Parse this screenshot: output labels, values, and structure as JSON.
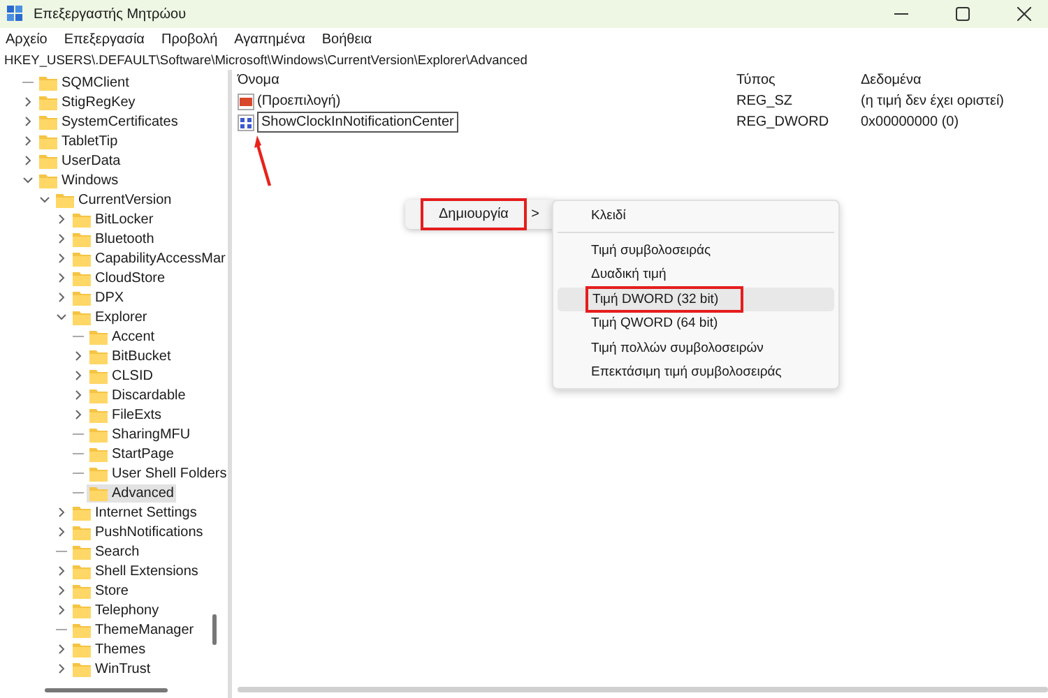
{
  "window": {
    "title": "Επεξεργαστής Μητρώου"
  },
  "menu_bar": [
    "Αρχείο",
    "Επεξεργασία",
    "Προβολή",
    "Αγαπημένα",
    "Βοήθεια"
  ],
  "address": "HKEY_USERS\\.DEFAULT\\Software\\Microsoft\\Windows\\CurrentVersion\\Explorer\\Advanced",
  "tree": [
    {
      "label": "SQMClient",
      "kind": "leaf",
      "selected": false
    },
    {
      "label": "StigRegKey",
      "kind": "collapsed",
      "selected": false
    },
    {
      "label": "SystemCertificates",
      "kind": "collapsed",
      "selected": false
    },
    {
      "label": "TabletTip",
      "kind": "collapsed",
      "selected": false
    },
    {
      "label": "UserData",
      "kind": "collapsed",
      "selected": false
    },
    {
      "label": "Windows",
      "kind": "expanded",
      "selected": false,
      "children": [
        {
          "label": "CurrentVersion",
          "kind": "expanded",
          "selected": false,
          "children": [
            {
              "label": "BitLocker",
              "kind": "collapsed",
              "selected": false
            },
            {
              "label": "Bluetooth",
              "kind": "collapsed",
              "selected": false
            },
            {
              "label": "CapabilityAccessMar",
              "kind": "collapsed",
              "selected": false
            },
            {
              "label": "CloudStore",
              "kind": "collapsed",
              "selected": false
            },
            {
              "label": "DPX",
              "kind": "collapsed",
              "selected": false
            },
            {
              "label": "Explorer",
              "kind": "expanded",
              "selected": false,
              "children": [
                {
                  "label": "Accent",
                  "kind": "leaf",
                  "selected": false
                },
                {
                  "label": "BitBucket",
                  "kind": "collapsed",
                  "selected": false
                },
                {
                  "label": "CLSID",
                  "kind": "collapsed",
                  "selected": false
                },
                {
                  "label": "Discardable",
                  "kind": "collapsed",
                  "selected": false
                },
                {
                  "label": "FileExts",
                  "kind": "collapsed",
                  "selected": false
                },
                {
                  "label": "SharingMFU",
                  "kind": "leaf",
                  "selected": false
                },
                {
                  "label": "StartPage",
                  "kind": "leaf",
                  "selected": false
                },
                {
                  "label": "User Shell Folders",
                  "kind": "leaf",
                  "selected": false
                },
                {
                  "label": "Advanced",
                  "kind": "leaf",
                  "selected": true
                }
              ]
            },
            {
              "label": "Internet Settings",
              "kind": "collapsed",
              "selected": false
            },
            {
              "label": "PushNotifications",
              "kind": "collapsed",
              "selected": false
            },
            {
              "label": "Search",
              "kind": "leaf",
              "selected": false
            },
            {
              "label": "Shell Extensions",
              "kind": "collapsed",
              "selected": false
            },
            {
              "label": "Store",
              "kind": "collapsed",
              "selected": false
            },
            {
              "label": "Telephony",
              "kind": "collapsed",
              "selected": false
            },
            {
              "label": "ThemeManager",
              "kind": "leaf",
              "selected": false
            },
            {
              "label": "Themes",
              "kind": "collapsed",
              "selected": false
            },
            {
              "label": "WinTrust",
              "kind": "collapsed",
              "selected": false
            }
          ]
        }
      ]
    }
  ],
  "values_table": {
    "columns": [
      "Όνομα",
      "Τύπος",
      "Δεδομένα"
    ],
    "rows": [
      {
        "kind": "string",
        "name": "(Προεπιλογή)",
        "type": "REG_SZ",
        "data": "(η τιμή δεν έχει οριστεί)",
        "editing": false
      },
      {
        "kind": "dword",
        "name": "ShowClockInNotificationCenter",
        "type": "REG_DWORD",
        "data": "0x00000000 (0)",
        "editing": true
      }
    ]
  },
  "context_menu": {
    "items": [
      {
        "label": "Δημιουργία",
        "arrow": ">",
        "highlighted": true
      }
    ],
    "submenu": [
      {
        "label": "Κλειδί",
        "separator_after": true,
        "hovered": false,
        "highlighted": false
      },
      {
        "label": "Τιμή συμβολοσειράς",
        "separator_after": false,
        "hovered": false,
        "highlighted": false
      },
      {
        "label": "Δυαδική τιμή",
        "separator_after": false,
        "hovered": false,
        "highlighted": false
      },
      {
        "label": "Τιμή DWORD (32 bit)",
        "separator_after": false,
        "hovered": true,
        "highlighted": true
      },
      {
        "label": "Τιμή QWORD (64 bit)",
        "separator_after": false,
        "hovered": false,
        "highlighted": false
      },
      {
        "label": "Τιμή πολλών συμβολοσειρών",
        "separator_after": false,
        "hovered": false,
        "highlighted": false
      },
      {
        "label": "Επεκτάσιμη τιμή συμβολοσειράς",
        "separator_after": false,
        "hovered": false,
        "highlighted": false
      }
    ]
  }
}
